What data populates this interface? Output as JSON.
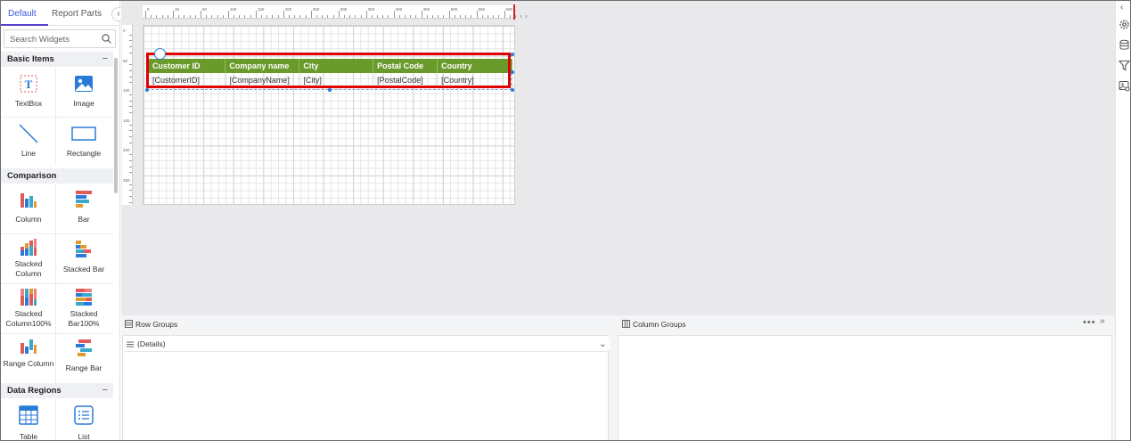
{
  "left_panel": {
    "tabs": [
      {
        "label": "Default"
      },
      {
        "label": "Report Parts"
      }
    ],
    "search_placeholder": "Search Widgets",
    "sections": [
      {
        "title": "Basic Items",
        "widgets": [
          {
            "label": "TextBox"
          },
          {
            "label": "Image"
          },
          {
            "label": "Line"
          },
          {
            "label": "Rectangle"
          }
        ]
      },
      {
        "title": "Comparison",
        "widgets": [
          {
            "label": "Column"
          },
          {
            "label": "Bar"
          },
          {
            "label": "Stacked Column"
          },
          {
            "label": "Stacked Bar"
          },
          {
            "label": "Stacked Column100%"
          },
          {
            "label": "Stacked Bar100%"
          },
          {
            "label": "Range Column"
          },
          {
            "label": "Range Bar"
          }
        ]
      },
      {
        "title": "Data Regions",
        "widgets": [
          {
            "label": "Table"
          },
          {
            "label": "List"
          }
        ]
      }
    ]
  },
  "ruler": {
    "top_labels": [
      "0",
      "10",
      "50",
      "100",
      "150",
      "200",
      "250",
      "300",
      "350",
      "400",
      "450",
      "500",
      "550",
      "600"
    ],
    "left_labels": [
      "0",
      "50",
      "100",
      "150",
      "200",
      "250"
    ]
  },
  "table": {
    "headers": [
      "Customer ID",
      "Company name",
      "City",
      "Postal Code",
      "Country"
    ],
    "row": [
      "[CustomerID]",
      "[CompanyName]",
      "[City]",
      "[PostalCode]",
      "[Country]"
    ]
  },
  "bottom": {
    "row_groups_title": "Row Groups",
    "column_groups_title": "Column Groups",
    "details_label": "(Details)"
  },
  "colors": {
    "header_bg": "#6b9a2c",
    "highlight": "#e00000",
    "accent": "#5b3fd0"
  }
}
